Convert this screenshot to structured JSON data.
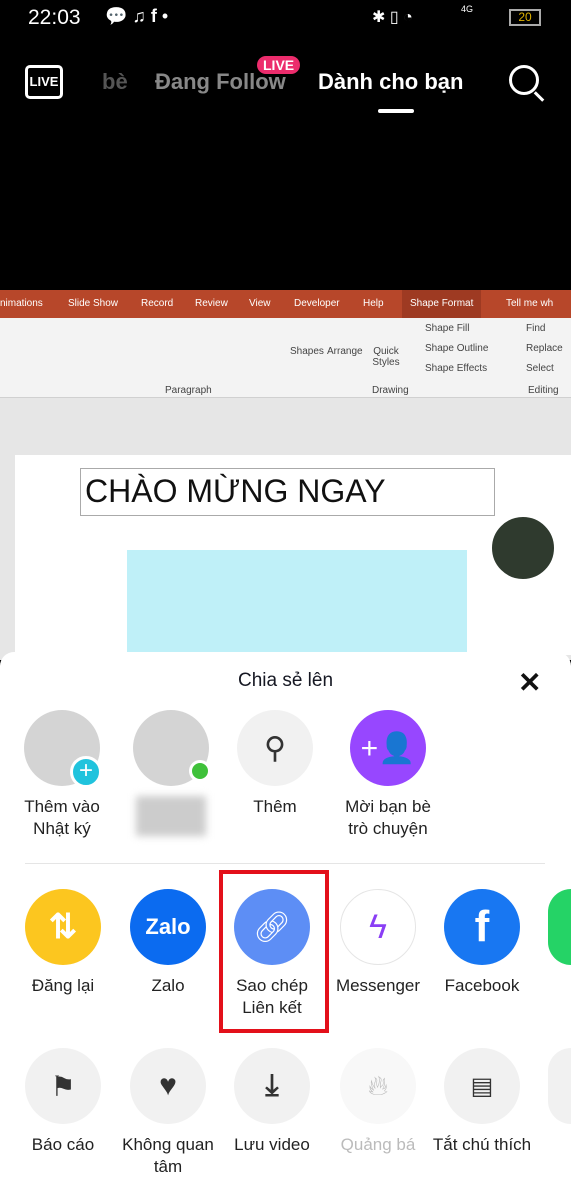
{
  "status": {
    "time": "22:03",
    "battery": "20",
    "network": "4G"
  },
  "topnav": {
    "tab_friends": "bè",
    "tab_following": "Đang Follow",
    "live_badge": "LIVE",
    "tab_foryou": "Dành cho bạn",
    "live_icon_text": "LIVE"
  },
  "ppt": {
    "tabs": [
      "nimations",
      "Slide Show",
      "Record",
      "Review",
      "View",
      "Developer",
      "Help",
      "Shape Format",
      "Tell me wh"
    ],
    "groups": [
      "Paragraph",
      "Drawing",
      "Editing"
    ],
    "buttons": [
      "Shapes",
      "Arrange",
      "Quick Styles",
      "Shape Fill",
      "Shape Outline",
      "Shape Effects",
      "Find",
      "Replace",
      "Select"
    ],
    "slide_title": "CHÀO MỪNG NGAY"
  },
  "share": {
    "title": "Chia sẻ lên",
    "row1": [
      {
        "label": "Thêm vào Nhật ký"
      },
      {
        "label": ""
      },
      {
        "label": "Thêm"
      },
      {
        "label": "Mời bạn bè trò chuyện"
      }
    ],
    "row2": [
      {
        "label": "Đăng lại",
        "color": "#fcc61f"
      },
      {
        "label": "Zalo",
        "color": "#0b6bf0",
        "text": "Zalo"
      },
      {
        "label": "Sao chép Liên kết",
        "color": "#5d8ef5"
      },
      {
        "label": "Messenger",
        "color": "#ffffff"
      },
      {
        "label": "Facebook",
        "color": "#1877f2"
      }
    ],
    "row3": [
      {
        "label": "Báo cáo"
      },
      {
        "label": "Không quan tâm"
      },
      {
        "label": "Lưu video"
      },
      {
        "label": "Quảng bá"
      },
      {
        "label": "Tắt chú thích"
      }
    ],
    "highlight_color": "#e3101a"
  }
}
